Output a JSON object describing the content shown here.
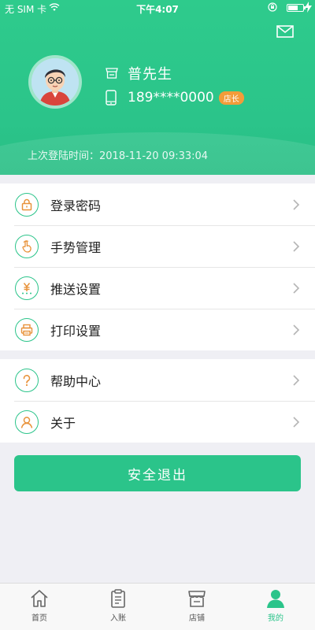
{
  "status_bar": {
    "carrier": "无 SIM 卡",
    "time": "下午4:07"
  },
  "profile": {
    "name": "普先生",
    "phone": "189****0000",
    "role_badge": "店长",
    "last_login": "上次登陆时间：2018-11-20 09:33:04"
  },
  "menu_group_1": [
    {
      "label": "登录密码",
      "icon": "lock-icon"
    },
    {
      "label": "手势管理",
      "icon": "hand-gesture-icon"
    },
    {
      "label": "推送设置",
      "icon": "yuan-push-icon"
    },
    {
      "label": "打印设置",
      "icon": "printer-icon"
    }
  ],
  "menu_group_2": [
    {
      "label": "帮助中心",
      "icon": "question-icon"
    },
    {
      "label": "关于",
      "icon": "user-icon"
    }
  ],
  "logout_label": "安全退出",
  "tabs": [
    {
      "label": "首页",
      "icon": "home-icon",
      "active": false
    },
    {
      "label": "入账",
      "icon": "clipboard-icon",
      "active": false
    },
    {
      "label": "店铺",
      "icon": "store-icon",
      "active": false
    },
    {
      "label": "我的",
      "icon": "person-icon",
      "active": true
    }
  ],
  "colors": {
    "accent": "#2bc48a",
    "badge": "#f39c3a",
    "icon_orange": "#e8923a"
  }
}
